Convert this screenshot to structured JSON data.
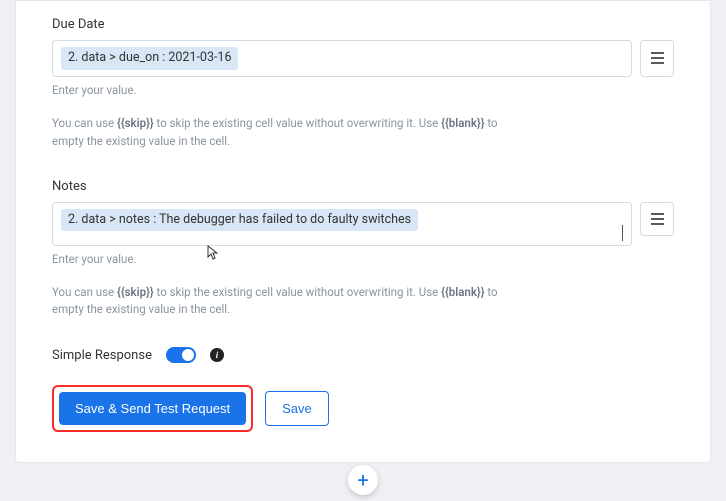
{
  "fields": {
    "due_date": {
      "label": "Due Date",
      "token": "2. data > due_on : 2021-03-16",
      "hint": "Enter your value.",
      "help_pre": "You can use ",
      "help_skip": "{{skip}}",
      "help_mid": " to skip the existing cell value without overwriting it. Use ",
      "help_blank": "{{blank}}",
      "help_post": " to empty the existing value in the cell."
    },
    "notes": {
      "label": "Notes",
      "token": "2. data > notes : The debugger has failed to do faulty switches",
      "hint": "Enter your value.",
      "help_pre": "You can use ",
      "help_skip": "{{skip}}",
      "help_mid": " to skip the existing cell value without overwriting it. Use ",
      "help_blank": "{{blank}}",
      "help_post": " to empty the existing value in the cell."
    }
  },
  "toggle": {
    "label": "Simple Response",
    "on": true
  },
  "buttons": {
    "primary": "Save & Send Test Request",
    "secondary": "Save"
  },
  "add_step": "+"
}
